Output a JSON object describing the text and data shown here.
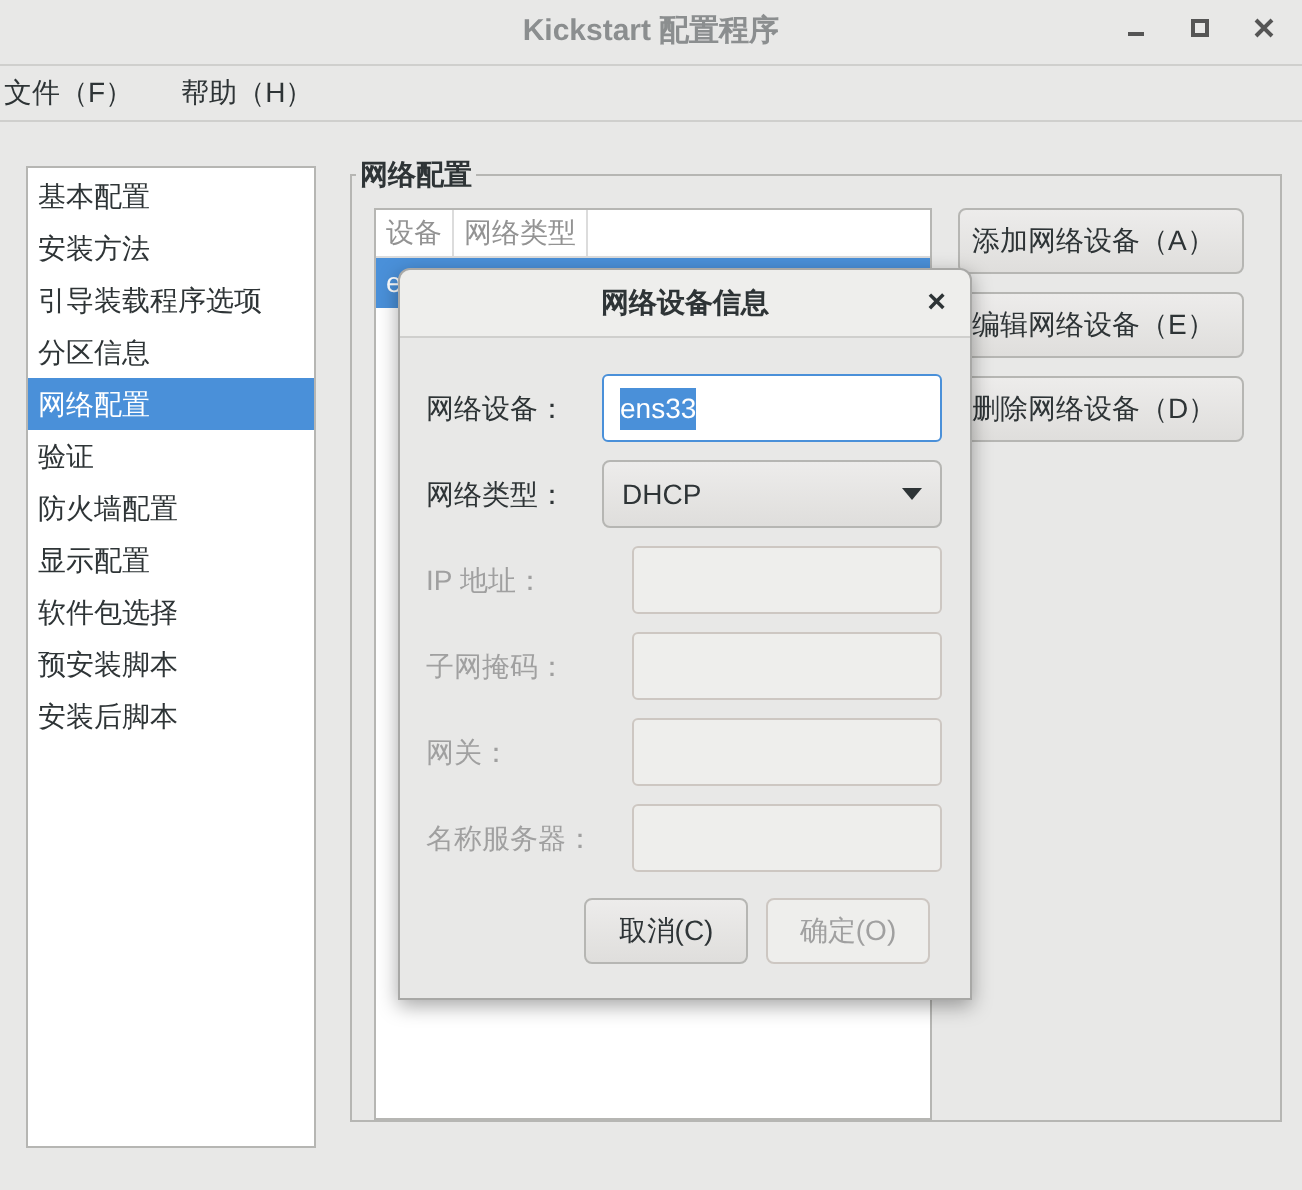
{
  "window": {
    "title": "Kickstart 配置程序"
  },
  "menu": [
    {
      "label": "文件（F）"
    },
    {
      "label": "帮助（H）"
    }
  ],
  "sidebar": {
    "items": [
      {
        "label": "基本配置",
        "selected": false
      },
      {
        "label": "安装方法",
        "selected": false
      },
      {
        "label": "引导装载程序选项",
        "selected": false
      },
      {
        "label": "分区信息",
        "selected": false
      },
      {
        "label": "网络配置",
        "selected": true
      },
      {
        "label": "验证",
        "selected": false
      },
      {
        "label": "防火墙配置",
        "selected": false
      },
      {
        "label": "显示配置",
        "selected": false
      },
      {
        "label": "软件包选择",
        "selected": false
      },
      {
        "label": "预安装脚本",
        "selected": false
      },
      {
        "label": "安装后脚本",
        "selected": false
      }
    ]
  },
  "section": {
    "title": "网络配置",
    "table": {
      "columns": [
        "设备",
        "网络类型"
      ],
      "rows": [
        {
          "cells": [
            "e"
          ],
          "selected": true
        }
      ]
    },
    "buttons": [
      "添加网络设备（A）",
      "编辑网络设备（E）",
      "删除网络设备（D）"
    ]
  },
  "dialog": {
    "title": "网络设备信息",
    "close": "×",
    "fields": [
      {
        "kind": "text",
        "label": "网络设备：",
        "value": "ens33",
        "text_selected": true,
        "disabled": false
      },
      {
        "kind": "dropdown",
        "label": "网络类型：",
        "value": "DHCP",
        "disabled": false
      },
      {
        "kind": "text",
        "label": "IP 地址：",
        "disabled": true
      },
      {
        "kind": "text",
        "label": "子网掩码：",
        "disabled": true
      },
      {
        "kind": "text",
        "label": "网关：",
        "disabled": true
      },
      {
        "kind": "text",
        "label": "名称服务器：",
        "disabled": true
      }
    ],
    "buttons": [
      {
        "label": "取消(C)",
        "disabled": false
      },
      {
        "label": "确定(O)",
        "disabled": true
      }
    ]
  }
}
